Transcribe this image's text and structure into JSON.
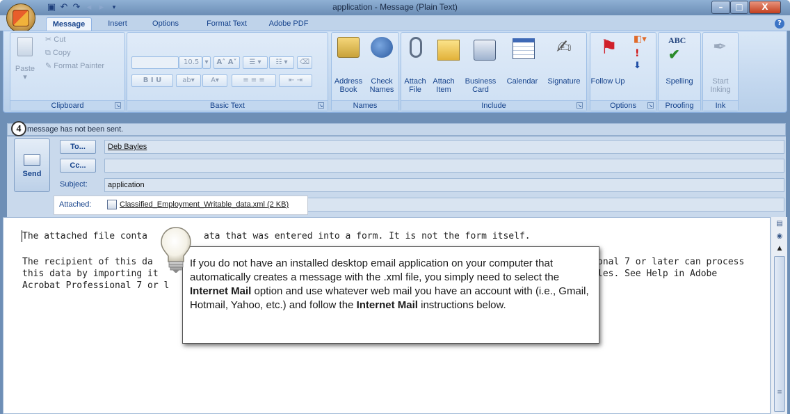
{
  "window": {
    "title": "application - Message (Plain Text)",
    "minimize_glyph": "–",
    "maximize_glyph": "□",
    "close_glyph": "X"
  },
  "qat": {
    "save": "save-icon",
    "undo": "undo-icon",
    "redo": "redo-icon"
  },
  "tabs": [
    {
      "label": "Message",
      "active": true
    },
    {
      "label": "Insert"
    },
    {
      "label": "Options"
    },
    {
      "label": "Format Text"
    },
    {
      "label": "Adobe PDF"
    }
  ],
  "ribbon": {
    "clipboard": {
      "label": "Clipboard",
      "paste": "Paste",
      "cut": "Cut",
      "copy": "Copy",
      "format_painter": "Format Painter"
    },
    "basic_text": {
      "label": "Basic Text",
      "font_size": "10.5"
    },
    "names": {
      "label": "Names",
      "address_book": "Address Book",
      "check_names": "Check Names"
    },
    "include": {
      "label": "Include",
      "attach_file": "Attach File",
      "attach_item": "Attach Item",
      "business_card": "Business Card",
      "calendar": "Calendar",
      "signature": "Signature"
    },
    "options": {
      "label": "Options",
      "follow_up": "Follow Up"
    },
    "proofing": {
      "label": "Proofing",
      "spelling": "Spelling"
    },
    "ink": {
      "label": "Ink",
      "start_inking": "Start Inking"
    }
  },
  "info": {
    "message": "message has not been sent.",
    "step_number": "4"
  },
  "header": {
    "send": "Send",
    "to_button": "To...",
    "to_value": "Deb Bayles",
    "cc_button": "Cc...",
    "cc_value": "",
    "subject_label": "Subject:",
    "subject_value": "application",
    "attached_label": "Attached:",
    "attachment_name": "Classified_Employment_Writable_data.xml (2 KB)"
  },
  "body": {
    "line1_a": "The attached file conta",
    "line1_b": "ata that was entered into a form. It is not the form itself.",
    "line2_a": "The recipient of this da",
    "line2_b": "onal 7 or later can process",
    "line3_a": "this data by importing it",
    "line3_b": "les. See Help in Adobe",
    "line4_a": "Acrobat Professional 7 or l"
  },
  "callout": {
    "part1": "If you do not have an installed desktop email application on your computer that automatically creates a message with the .xml file, you simply need to select the ",
    "bold1": "Internet Mail",
    "part2": " option and use whatever web mail you have an account with (i.e., Gmail, Hotmail, Yahoo, etc.) and follow the ",
    "bold2": "Internet Mail",
    "part3": " instructions below."
  }
}
